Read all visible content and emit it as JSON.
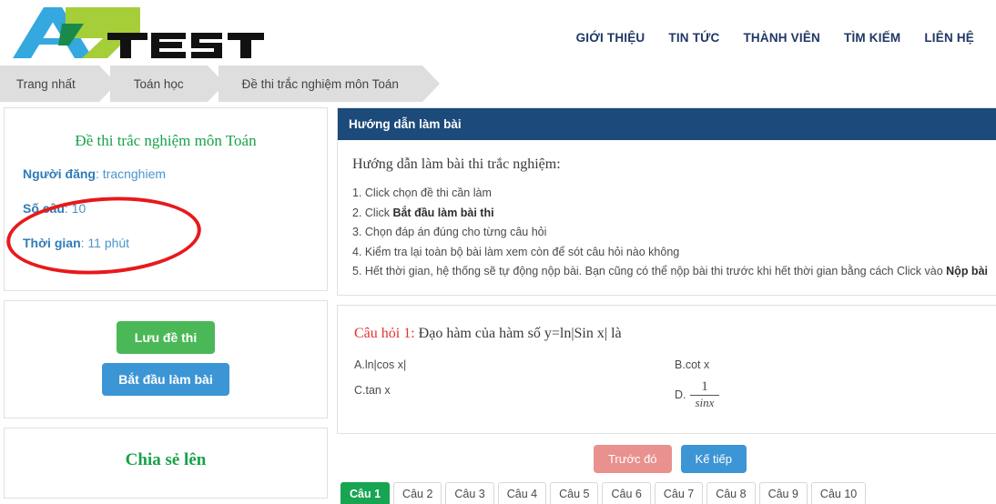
{
  "brand": {
    "logo_az": "AZ",
    "logo_test": "TEST",
    "color_blue": "#35a8e0",
    "color_green": "#a6ce39",
    "color_dark_green": "#1a8a4a"
  },
  "nav": {
    "items": [
      {
        "label": "GIỚI THIỆU",
        "name": "nav-gioi-thieu"
      },
      {
        "label": "TIN TỨC",
        "name": "nav-tin-tuc"
      },
      {
        "label": "THÀNH VIÊN",
        "name": "nav-thanh-vien"
      },
      {
        "label": "TÌM KIẾM",
        "name": "nav-tim-kiem"
      },
      {
        "label": "LIÊN HỆ",
        "name": "nav-lien-he"
      }
    ]
  },
  "breadcrumb": {
    "items": [
      {
        "label": "Trang nhất"
      },
      {
        "label": "Toán học"
      },
      {
        "label": "Đề thi trắc nghiệm môn Toán"
      }
    ]
  },
  "exam_info": {
    "title": "Đề thi trắc nghiệm môn Toán",
    "poster_label": "Người đăng",
    "poster_value": ": tracnghiem",
    "count_label": "Số câu",
    "count_value": ": 10",
    "time_label": "Thời gian",
    "time_value": ": 11 phút",
    "annotation_color": "#e8191b"
  },
  "actions": {
    "save_label": "Lưu đề thi",
    "start_label": "Bắt đầu làm bài",
    "save_color": "#4bb857",
    "start_color": "#3c95d4"
  },
  "share": {
    "title": "Chia sẻ lên"
  },
  "guide": {
    "header": "Hướng dẫn làm bài",
    "heading": "Hướng dẫn làm bài thi trắc nghiệm:",
    "items": [
      {
        "plain": "1. Click chọn đề thi cần làm",
        "bold": "",
        "tail": ""
      },
      {
        "plain": "2. Click ",
        "bold": "Bắt đầu làm bài thi",
        "tail": ""
      },
      {
        "plain": "3. Chọn đáp án đúng cho từng câu hỏi",
        "bold": "",
        "tail": ""
      },
      {
        "plain": "4. Kiểm tra lại toàn bộ bài làm xem còn để sót câu hỏi nào không",
        "bold": "",
        "tail": ""
      },
      {
        "plain": "5. Hết thời gian, hệ thống sẽ tự động nộp bài. Bạn cũng có thể nộp bài thi trước khi hết thời gian bằng cách Click vào ",
        "bold": "Nộp bài",
        "tail": ""
      }
    ],
    "header_color": "#1c4a7a"
  },
  "question": {
    "label": "Câu hỏi 1:",
    "text": " Đạo hàm của hàm số y=ln|Sin x| là",
    "answers": [
      {
        "key": "A.",
        "text": " ln|cos x|",
        "fraction": null
      },
      {
        "key": "B.",
        "text": " cot x",
        "fraction": null
      },
      {
        "key": "C.",
        "text": " tan x",
        "fraction": null
      },
      {
        "key": "D.",
        "text": "",
        "fraction": {
          "num": "1",
          "den": "sinx"
        }
      }
    ]
  },
  "qnav": {
    "prev_label": "Trước đó",
    "next_label": "Kế tiếp",
    "prev_color": "#e8918f",
    "next_color": "#3c95d4"
  },
  "qtabs": {
    "active_index": 0,
    "active_color": "#18a552",
    "items": [
      {
        "label": "Câu 1"
      },
      {
        "label": "Câu 2"
      },
      {
        "label": "Câu 3"
      },
      {
        "label": "Câu 4"
      },
      {
        "label": "Câu 5"
      },
      {
        "label": "Câu 6"
      },
      {
        "label": "Câu 7"
      },
      {
        "label": "Câu 8"
      },
      {
        "label": "Câu 9"
      },
      {
        "label": "Câu 10"
      }
    ]
  }
}
